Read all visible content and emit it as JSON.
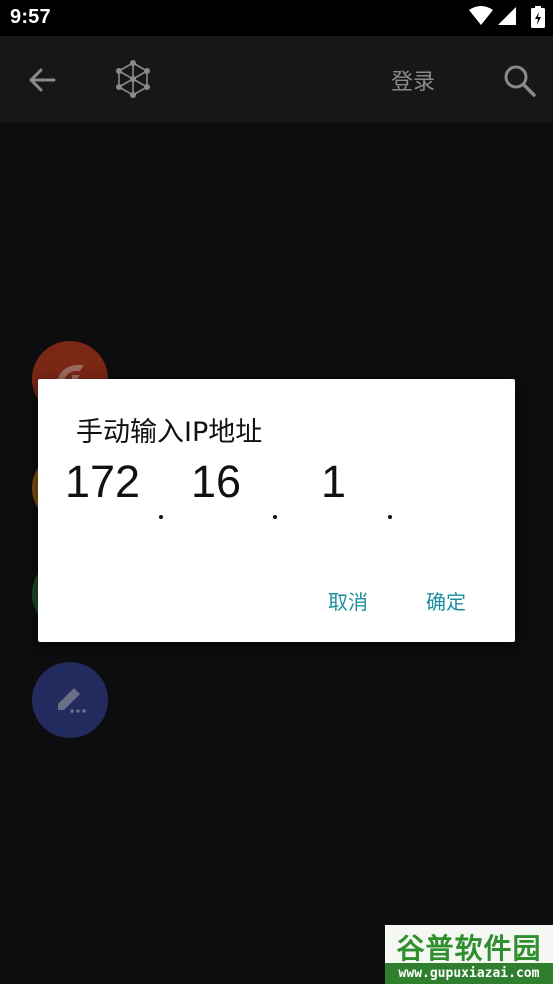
{
  "status_bar": {
    "time": "9:57"
  },
  "app_bar": {
    "login_label": "登录"
  },
  "dialog": {
    "title": "手动输入IP地址",
    "ip_segments": [
      "172",
      "16",
      "1",
      ""
    ],
    "cancel_label": "取消",
    "confirm_label": "确定"
  },
  "watermark": {
    "top": "谷普软件园",
    "bottom": "www.gupuxiazai.com"
  },
  "colors": {
    "dialog_button": "#1b8ea0",
    "app_bar": "#17171a",
    "background": "#0d0d0f"
  }
}
